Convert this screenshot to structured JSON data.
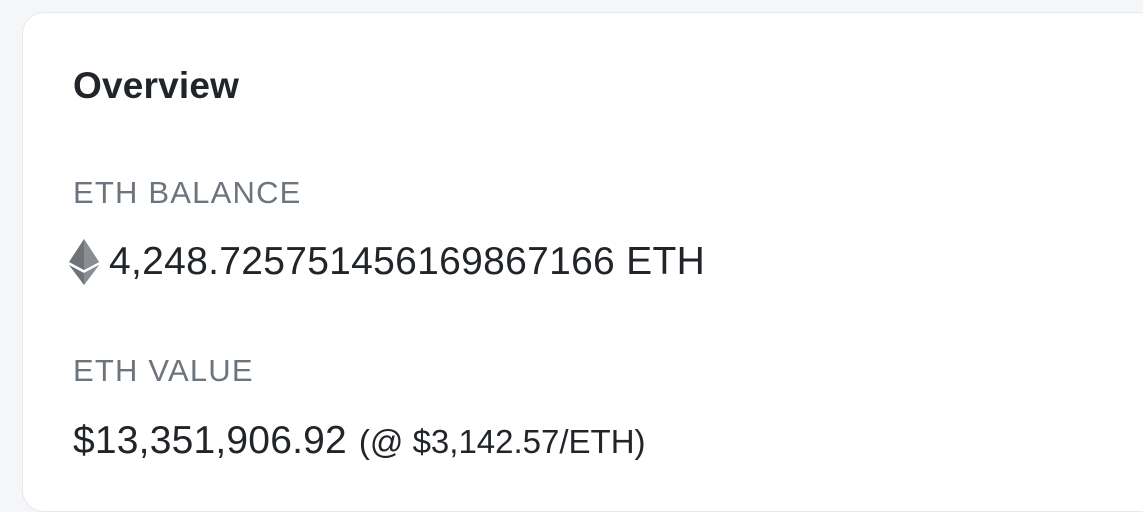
{
  "overview": {
    "title": "Overview",
    "eth_balance": {
      "label": "ETH BALANCE",
      "icon": "ethereum-icon",
      "amount": "4,248.725751456169867166 ETH"
    },
    "eth_value": {
      "label": "ETH VALUE",
      "usd_value": "$13,351,906.92",
      "rate": "(@ $3,142.57/ETH)"
    }
  },
  "colors": {
    "text_primary": "#212529",
    "text_muted": "#6c757d",
    "card_background": "#ffffff",
    "page_background": "#f5f6f8"
  }
}
